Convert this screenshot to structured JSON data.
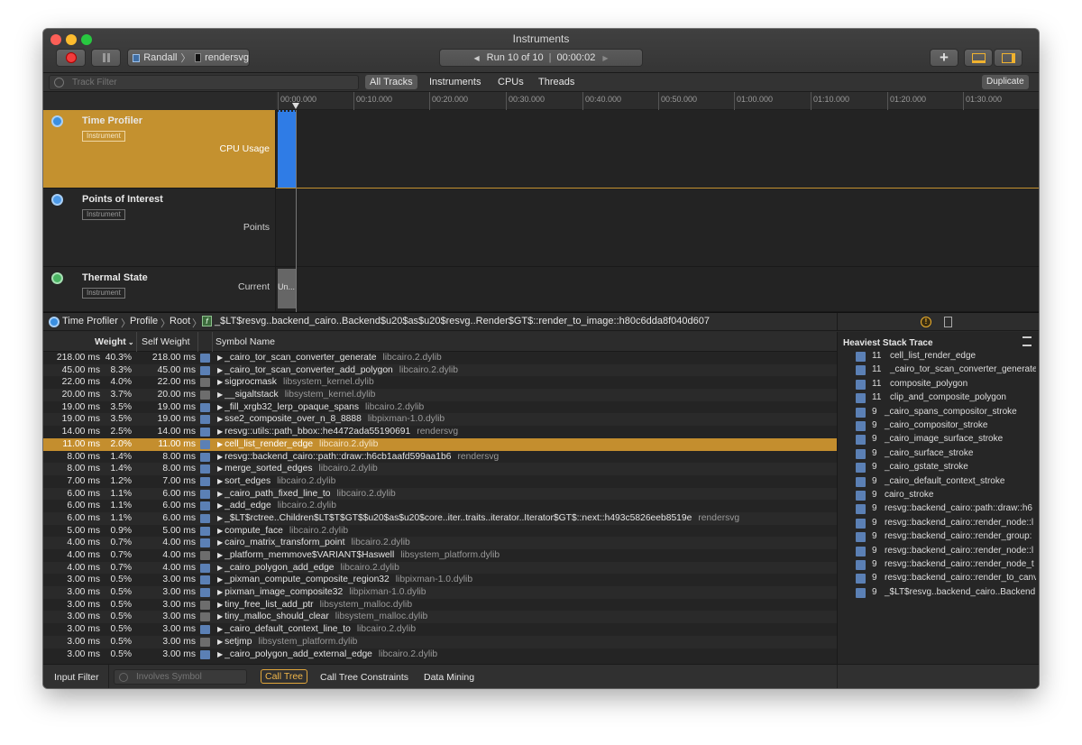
{
  "window": {
    "title": "Instruments"
  },
  "toolbar": {
    "user": "Randall",
    "target": "rendersvg",
    "run_label": "Run 10 of 10",
    "run_time": "00:00:02"
  },
  "filter": {
    "placeholder": "Track Filter",
    "tabs": [
      "All Tracks",
      "Instruments",
      "CPUs",
      "Threads"
    ],
    "duplicate": "Duplicate"
  },
  "ruler": [
    "00:00.000",
    "00:10.000",
    "00:20.000",
    "00:30.000",
    "00:40.000",
    "00:50.000",
    "01:00.000",
    "01:10.000",
    "01:20.000",
    "01:30.000"
  ],
  "tracks": [
    {
      "name": "Time Profiler",
      "badge": "Instrument",
      "caption": "CPU Usage",
      "color": "#3a8fe0"
    },
    {
      "name": "Points of Interest",
      "badge": "Instrument",
      "caption": "Points",
      "color": "#4d9ae8"
    },
    {
      "name": "Thermal State",
      "badge": "Instrument",
      "caption": "Current",
      "color": "#4ab563",
      "bar_text": "Un..."
    }
  ],
  "breadcrumb": {
    "items": [
      "Time Profiler",
      "Profile",
      "Root"
    ],
    "symbol": "_$LT$resvg..backend_cairo..Backend$u20$as$u20$resvg..Render$GT$::render_to_image::h80c6dda8f040d607"
  },
  "columns": {
    "weight": "Weight",
    "self": "Self Weight",
    "symbol": "Symbol Name"
  },
  "rows": [
    {
      "w": "218.00 ms",
      "p": "40.3%",
      "s": "218.00 ms",
      "n": "_cairo_tor_scan_converter_generate",
      "lib": "libcairo.2.dylib",
      "i": "user"
    },
    {
      "w": "45.00 ms",
      "p": "8.3%",
      "s": "45.00 ms",
      "n": "_cairo_tor_scan_converter_add_polygon",
      "lib": "libcairo.2.dylib",
      "i": "user"
    },
    {
      "w": "22.00 ms",
      "p": "4.0%",
      "s": "22.00 ms",
      "n": "sigprocmask",
      "lib": "libsystem_kernel.dylib",
      "i": "sys"
    },
    {
      "w": "20.00 ms",
      "p": "3.7%",
      "s": "20.00 ms",
      "n": "__sigaltstack",
      "lib": "libsystem_kernel.dylib",
      "i": "sys"
    },
    {
      "w": "19.00 ms",
      "p": "3.5%",
      "s": "19.00 ms",
      "n": "_fill_xrgb32_lerp_opaque_spans",
      "lib": "libcairo.2.dylib",
      "i": "user"
    },
    {
      "w": "19.00 ms",
      "p": "3.5%",
      "s": "19.00 ms",
      "n": "sse2_composite_over_n_8_8888",
      "lib": "libpixman-1.0.dylib",
      "i": "user"
    },
    {
      "w": "14.00 ms",
      "p": "2.5%",
      "s": "14.00 ms",
      "n": "resvg::utils::path_bbox::he4472ada55190691",
      "lib": "rendersvg",
      "i": "user"
    },
    {
      "w": "11.00 ms",
      "p": "2.0%",
      "s": "11.00 ms",
      "n": "cell_list_render_edge",
      "lib": "libcairo.2.dylib",
      "i": "user",
      "sel": true
    },
    {
      "w": "8.00 ms",
      "p": "1.4%",
      "s": "8.00 ms",
      "n": "resvg::backend_cairo::path::draw::h6cb1aafd599aa1b6",
      "lib": "rendersvg",
      "i": "user"
    },
    {
      "w": "8.00 ms",
      "p": "1.4%",
      "s": "8.00 ms",
      "n": "merge_sorted_edges",
      "lib": "libcairo.2.dylib",
      "i": "user"
    },
    {
      "w": "7.00 ms",
      "p": "1.2%",
      "s": "7.00 ms",
      "n": "sort_edges",
      "lib": "libcairo.2.dylib",
      "i": "user"
    },
    {
      "w": "6.00 ms",
      "p": "1.1%",
      "s": "6.00 ms",
      "n": "_cairo_path_fixed_line_to",
      "lib": "libcairo.2.dylib",
      "i": "user"
    },
    {
      "w": "6.00 ms",
      "p": "1.1%",
      "s": "6.00 ms",
      "n": "_add_edge",
      "lib": "libcairo.2.dylib",
      "i": "user"
    },
    {
      "w": "6.00 ms",
      "p": "1.1%",
      "s": "6.00 ms",
      "n": "_$LT$rctree..Children$LT$T$GT$$u20$as$u20$core..iter..traits..iterator..Iterator$GT$::next::h493c5826eeb8519e",
      "lib": "rendersvg",
      "i": "user"
    },
    {
      "w": "5.00 ms",
      "p": "0.9%",
      "s": "5.00 ms",
      "n": "compute_face",
      "lib": "libcairo.2.dylib",
      "i": "user"
    },
    {
      "w": "4.00 ms",
      "p": "0.7%",
      "s": "4.00 ms",
      "n": "cairo_matrix_transform_point",
      "lib": "libcairo.2.dylib",
      "i": "user"
    },
    {
      "w": "4.00 ms",
      "p": "0.7%",
      "s": "4.00 ms",
      "n": "_platform_memmove$VARIANT$Haswell",
      "lib": "libsystem_platform.dylib",
      "i": "sys"
    },
    {
      "w": "4.00 ms",
      "p": "0.7%",
      "s": "4.00 ms",
      "n": "_cairo_polygon_add_edge",
      "lib": "libcairo.2.dylib",
      "i": "user"
    },
    {
      "w": "3.00 ms",
      "p": "0.5%",
      "s": "3.00 ms",
      "n": "_pixman_compute_composite_region32",
      "lib": "libpixman-1.0.dylib",
      "i": "user"
    },
    {
      "w": "3.00 ms",
      "p": "0.5%",
      "s": "3.00 ms",
      "n": "pixman_image_composite32",
      "lib": "libpixman-1.0.dylib",
      "i": "user"
    },
    {
      "w": "3.00 ms",
      "p": "0.5%",
      "s": "3.00 ms",
      "n": "tiny_free_list_add_ptr",
      "lib": "libsystem_malloc.dylib",
      "i": "sys"
    },
    {
      "w": "3.00 ms",
      "p": "0.5%",
      "s": "3.00 ms",
      "n": "tiny_malloc_should_clear",
      "lib": "libsystem_malloc.dylib",
      "i": "sys"
    },
    {
      "w": "3.00 ms",
      "p": "0.5%",
      "s": "3.00 ms",
      "n": "_cairo_default_context_line_to",
      "lib": "libcairo.2.dylib",
      "i": "user"
    },
    {
      "w": "3.00 ms",
      "p": "0.5%",
      "s": "3.00 ms",
      "n": "setjmp",
      "lib": "libsystem_platform.dylib",
      "i": "sys"
    },
    {
      "w": "3.00 ms",
      "p": "0.5%",
      "s": "3.00 ms",
      "n": "_cairo_polygon_add_external_edge",
      "lib": "libcairo.2.dylib",
      "i": "user"
    }
  ],
  "heaviest": {
    "title": "Heaviest Stack Trace",
    "items": [
      {
        "c": "11",
        "n": "cell_list_render_edge",
        "indent": 1
      },
      {
        "c": "11",
        "n": "_cairo_tor_scan_converter_generate",
        "indent": 1
      },
      {
        "c": "11",
        "n": "composite_polygon",
        "indent": 1
      },
      {
        "c": "11",
        "n": "clip_and_composite_polygon",
        "indent": 1
      },
      {
        "c": "9",
        "n": "_cairo_spans_compositor_stroke",
        "indent": 0
      },
      {
        "c": "9",
        "n": "_cairo_compositor_stroke",
        "indent": 0
      },
      {
        "c": "9",
        "n": "_cairo_image_surface_stroke",
        "indent": 0
      },
      {
        "c": "9",
        "n": "_cairo_surface_stroke",
        "indent": 0
      },
      {
        "c": "9",
        "n": "_cairo_gstate_stroke",
        "indent": 0
      },
      {
        "c": "9",
        "n": "_cairo_default_context_stroke",
        "indent": 0
      },
      {
        "c": "9",
        "n": "cairo_stroke",
        "indent": 0
      },
      {
        "c": "9",
        "n": "resvg::backend_cairo::path::draw::h6",
        "indent": 0
      },
      {
        "c": "9",
        "n": "resvg::backend_cairo::render_node::l",
        "indent": 0
      },
      {
        "c": "9",
        "n": "resvg::backend_cairo::render_group:",
        "indent": 0
      },
      {
        "c": "9",
        "n": "resvg::backend_cairo::render_node::l",
        "indent": 0
      },
      {
        "c": "9",
        "n": "resvg::backend_cairo::render_node_t",
        "indent": 0
      },
      {
        "c": "9",
        "n": "resvg::backend_cairo::render_to_canv",
        "indent": 0
      },
      {
        "c": "9",
        "n": "_$LT$resvg..backend_cairo..Backend",
        "indent": 0
      }
    ]
  },
  "bottom": {
    "input_filter": "Input Filter",
    "involves_placeholder": "Involves Symbol",
    "call_tree": "Call Tree",
    "constraints": "Call Tree Constraints",
    "data_mining": "Data Mining"
  }
}
